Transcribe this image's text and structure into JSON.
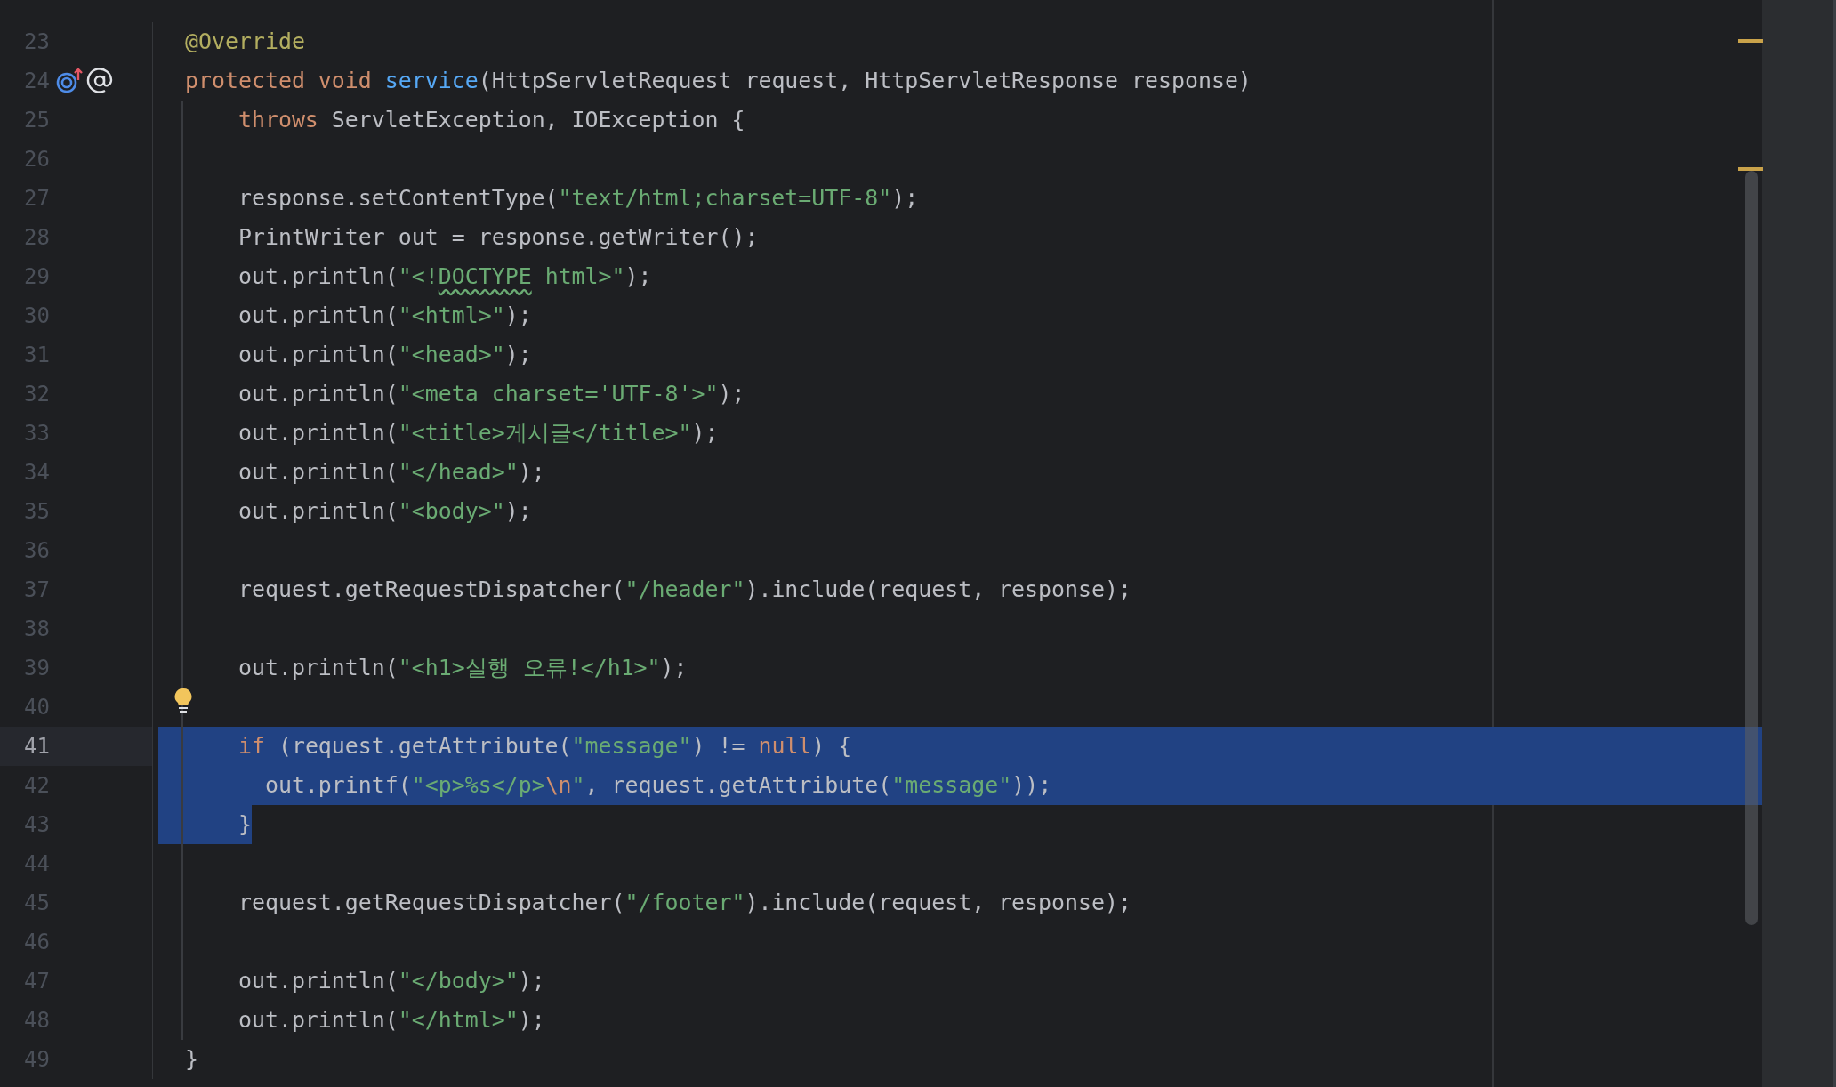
{
  "editor": {
    "lines": [
      {
        "number": "23",
        "current": false,
        "selected": false,
        "tokens": [
          {
            "text": "@Override",
            "kind": "annotation"
          }
        ]
      },
      {
        "number": "24",
        "current": false,
        "selected": false,
        "gutter_icons": [
          {
            "kind": "overrides"
          },
          {
            "kind": "annotated"
          }
        ],
        "tokens": [
          {
            "text": "protected void ",
            "kind": "keyword"
          },
          {
            "text": "service",
            "kind": "declaration"
          },
          {
            "text": "(HttpServletRequest request, HttpServletResponse response)",
            "kind": "plain"
          }
        ]
      },
      {
        "number": "25",
        "current": false,
        "selected": false,
        "tokens": [
          {
            "text": "    throws ",
            "kind": "keyword"
          },
          {
            "text": "ServletException, IOException {",
            "kind": "plain"
          }
        ]
      },
      {
        "number": "26",
        "current": false,
        "selected": false
      },
      {
        "number": "27",
        "current": false,
        "selected": false,
        "tokens": [
          {
            "text": "    response.setContentType(",
            "kind": "plain"
          },
          {
            "text": "\"text/html;charset=UTF-8\"",
            "kind": "string"
          },
          {
            "text": ");",
            "kind": "plain"
          }
        ]
      },
      {
        "number": "28",
        "current": false,
        "selected": false,
        "tokens": [
          {
            "text": "    PrintWriter out = response.getWriter();",
            "kind": "plain"
          }
        ]
      },
      {
        "number": "29",
        "current": false,
        "selected": false,
        "tokens": [
          {
            "text": "    out.println(",
            "kind": "plain"
          },
          {
            "text": "\"<!",
            "kind": "string"
          },
          {
            "text": "DOCTYPE",
            "kind": "string",
            "warning": true
          },
          {
            "text": " html>\"",
            "kind": "string"
          },
          {
            "text": ");",
            "kind": "plain"
          }
        ]
      },
      {
        "number": "30",
        "current": false,
        "selected": false,
        "tokens": [
          {
            "text": "    out.println(",
            "kind": "plain"
          },
          {
            "text": "\"<html>\"",
            "kind": "string"
          },
          {
            "text": ");",
            "kind": "plain"
          }
        ]
      },
      {
        "number": "31",
        "current": false,
        "selected": false,
        "tokens": [
          {
            "text": "    out.println(",
            "kind": "plain"
          },
          {
            "text": "\"<head>\"",
            "kind": "string"
          },
          {
            "text": ");",
            "kind": "plain"
          }
        ]
      },
      {
        "number": "32",
        "current": false,
        "selected": false,
        "tokens": [
          {
            "text": "    out.println(",
            "kind": "plain"
          },
          {
            "text": "\"<meta charset='UTF-8'>\"",
            "kind": "string"
          },
          {
            "text": ");",
            "kind": "plain"
          }
        ]
      },
      {
        "number": "33",
        "current": false,
        "selected": false,
        "tokens": [
          {
            "text": "    out.println(",
            "kind": "plain"
          },
          {
            "text": "\"<title>게시글</title>\"",
            "kind": "string"
          },
          {
            "text": ");",
            "kind": "plain"
          }
        ]
      },
      {
        "number": "34",
        "current": false,
        "selected": false,
        "tokens": [
          {
            "text": "    out.println(",
            "kind": "plain"
          },
          {
            "text": "\"</head>\"",
            "kind": "string"
          },
          {
            "text": ");",
            "kind": "plain"
          }
        ]
      },
      {
        "number": "35",
        "current": false,
        "selected": false,
        "tokens": [
          {
            "text": "    out.println(",
            "kind": "plain"
          },
          {
            "text": "\"<body>\"",
            "kind": "string"
          },
          {
            "text": ");",
            "kind": "plain"
          }
        ]
      },
      {
        "number": "36",
        "current": false,
        "selected": false
      },
      {
        "number": "37",
        "current": false,
        "selected": false,
        "tokens": [
          {
            "text": "    request.getRequestDispatcher(",
            "kind": "plain"
          },
          {
            "text": "\"/header\"",
            "kind": "string"
          },
          {
            "text": ").include(request, response);",
            "kind": "plain"
          }
        ]
      },
      {
        "number": "38",
        "current": false,
        "selected": false
      },
      {
        "number": "39",
        "current": false,
        "selected": false,
        "tokens": [
          {
            "text": "    out.println(",
            "kind": "plain"
          },
          {
            "text": "\"<h1>실행 오류!</h1>\"",
            "kind": "string"
          },
          {
            "text": ");",
            "kind": "plain"
          }
        ]
      },
      {
        "number": "40",
        "current": false,
        "selected": false,
        "bulb": true
      },
      {
        "number": "41",
        "current": true,
        "selected": true,
        "selection_to_end": true,
        "tokens": [
          {
            "text": "    if ",
            "kind": "keyword"
          },
          {
            "text": "(request.getAttribute(",
            "kind": "plain"
          },
          {
            "text": "\"message\"",
            "kind": "string"
          },
          {
            "text": ") != ",
            "kind": "plain"
          },
          {
            "text": "null",
            "kind": "keyword"
          },
          {
            "text": ") {",
            "kind": "plain"
          }
        ]
      },
      {
        "number": "42",
        "current": false,
        "selected": true,
        "selection_to_end": true,
        "tokens": [
          {
            "text": "      out.printf(",
            "kind": "plain"
          },
          {
            "text": "\"<p>%s</p>",
            "kind": "string"
          },
          {
            "text": "\\n",
            "kind": "escape"
          },
          {
            "text": "\"",
            "kind": "string"
          },
          {
            "text": ", request.getAttribute(",
            "kind": "plain"
          },
          {
            "text": "\"message\"",
            "kind": "string"
          },
          {
            "text": "));",
            "kind": "plain"
          }
        ]
      },
      {
        "number": "43",
        "current": false,
        "selected": true,
        "selection_to_end": false,
        "tokens": [
          {
            "text": "    }",
            "kind": "plain"
          }
        ]
      },
      {
        "number": "44",
        "current": false,
        "selected": false
      },
      {
        "number": "45",
        "current": false,
        "selected": false,
        "tokens": [
          {
            "text": "    request.getRequestDispatcher(",
            "kind": "plain"
          },
          {
            "text": "\"/footer\"",
            "kind": "string"
          },
          {
            "text": ").include(request, response);",
            "kind": "plain"
          }
        ]
      },
      {
        "number": "46",
        "current": false,
        "selected": false
      },
      {
        "number": "47",
        "current": false,
        "selected": false,
        "tokens": [
          {
            "text": "    out.println(",
            "kind": "plain"
          },
          {
            "text": "\"</body>\"",
            "kind": "string"
          },
          {
            "text": ");",
            "kind": "plain"
          }
        ]
      },
      {
        "number": "48",
        "current": false,
        "selected": false,
        "tokens": [
          {
            "text": "    out.println(",
            "kind": "plain"
          },
          {
            "text": "\"</html>\"",
            "kind": "string"
          },
          {
            "text": ");",
            "kind": "plain"
          }
        ]
      },
      {
        "number": "49",
        "current": false,
        "selected": false,
        "tokens": [
          {
            "text": "}",
            "kind": "plain"
          }
        ]
      }
    ]
  }
}
